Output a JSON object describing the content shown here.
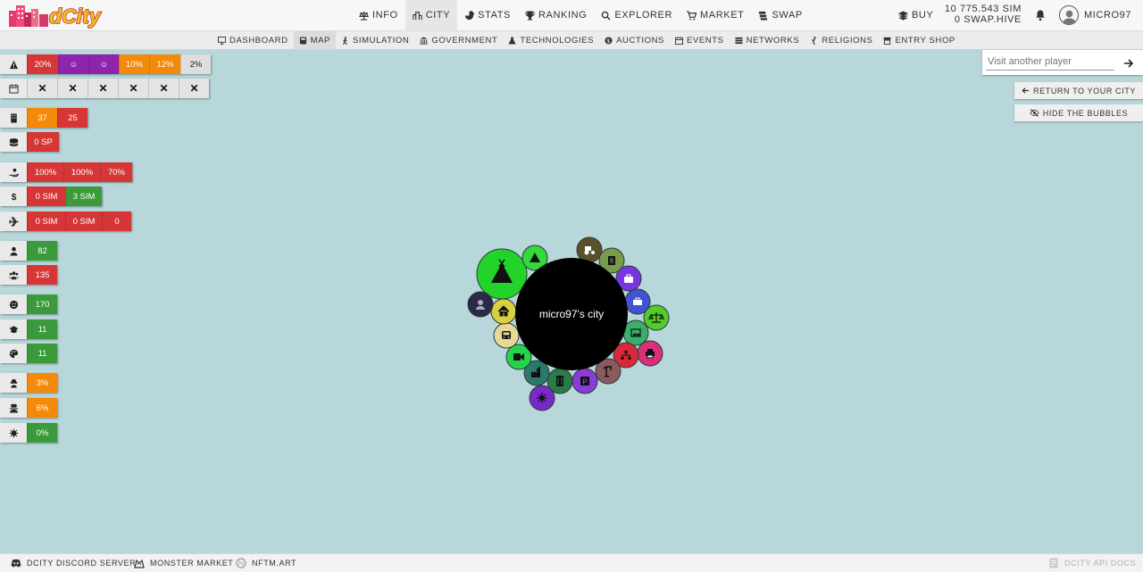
{
  "brand": {
    "logo_text": "dCity"
  },
  "topnav": [
    {
      "label": "Info",
      "icon": "balance-scale-icon"
    },
    {
      "label": "City",
      "icon": "city-icon",
      "active": true
    },
    {
      "label": "Stats",
      "icon": "pie-chart-icon"
    },
    {
      "label": "Ranking",
      "icon": "trophy-icon"
    },
    {
      "label": "Explorer",
      "icon": "search-icon"
    },
    {
      "label": "Market",
      "icon": "cart-icon"
    },
    {
      "label": "Swap",
      "icon": "swap-icon"
    }
  ],
  "header": {
    "buy_label": "Buy",
    "balance_sim": "10 775.543 SIM",
    "balance_swap": "0 SWAP.HIVE",
    "username": "MICRO97"
  },
  "subnav": [
    {
      "label": "Dashboard",
      "icon": "monitor-icon"
    },
    {
      "label": "Map",
      "icon": "map-icon",
      "active": true
    },
    {
      "label": "Simulation",
      "icon": "walking-icon"
    },
    {
      "label": "Government",
      "icon": "government-icon"
    },
    {
      "label": "Technologies",
      "icon": "flask-icon"
    },
    {
      "label": "Auctions",
      "icon": "gavel-icon"
    },
    {
      "label": "Events",
      "icon": "calendar-icon"
    },
    {
      "label": "Networks",
      "icon": "network-icon"
    },
    {
      "label": "Religions",
      "icon": "pray-icon"
    },
    {
      "label": "Entry Shop",
      "icon": "shop-icon"
    }
  ],
  "stats_rows": [
    {
      "icon": "warning-icon",
      "cells": [
        {
          "text": "20%",
          "color": "red"
        },
        {
          "text": "☺",
          "color": "purple"
        },
        {
          "text": "☺",
          "color": "purple"
        },
        {
          "text": "10%",
          "color": "orange"
        },
        {
          "text": "12%",
          "color": "orange"
        },
        {
          "text": "2%",
          "color": "grey"
        }
      ]
    },
    {
      "icon": "calendar-icon",
      "cells": [
        {
          "text": "✕",
          "color": "x"
        },
        {
          "text": "✕",
          "color": "x"
        },
        {
          "text": "✕",
          "color": "x"
        },
        {
          "text": "✕",
          "color": "x"
        },
        {
          "text": "✕",
          "color": "x"
        },
        {
          "text": "✕",
          "color": "x"
        }
      ]
    },
    {
      "icon": "building-icon",
      "cells": [
        {
          "text": "37",
          "color": "orange"
        },
        {
          "text": "25",
          "color": "red"
        }
      ]
    },
    {
      "icon": "coins-icon",
      "cells": [
        {
          "text": "0 SP",
          "color": "red"
        }
      ]
    },
    {
      "icon": "hand-coin-icon",
      "cells": [
        {
          "text": "100%",
          "color": "red"
        },
        {
          "text": "100%",
          "color": "red"
        },
        {
          "text": "70%",
          "color": "red"
        }
      ]
    },
    {
      "icon": "dollar-icon",
      "cells": [
        {
          "text": "0 SIM",
          "color": "red"
        },
        {
          "text": "3 SIM",
          "color": "green"
        }
      ]
    },
    {
      "icon": "plane-icon",
      "cells": [
        {
          "text": "0 SIM",
          "color": "red"
        },
        {
          "text": "0 SIM",
          "color": "red"
        },
        {
          "text": "0",
          "color": "red"
        }
      ]
    },
    {
      "icon": "person-icon",
      "cells": [
        {
          "text": "82",
          "color": "green"
        }
      ]
    },
    {
      "icon": "people-icon",
      "cells": [
        {
          "text": "135",
          "color": "red"
        }
      ]
    },
    {
      "icon": "smile-icon",
      "cells": [
        {
          "text": "170",
          "color": "green"
        }
      ]
    },
    {
      "icon": "graduation-cap-icon",
      "cells": [
        {
          "text": "11",
          "color": "green"
        }
      ]
    },
    {
      "icon": "palette-icon",
      "cells": [
        {
          "text": "11",
          "color": "green"
        }
      ]
    },
    {
      "icon": "thief-icon",
      "cells": [
        {
          "text": "3%",
          "color": "orange"
        }
      ]
    },
    {
      "icon": "unemployed-icon",
      "cells": [
        {
          "text": "6%",
          "color": "orange"
        }
      ]
    },
    {
      "icon": "virus-icon",
      "cells": [
        {
          "text": "0%",
          "color": "green"
        }
      ]
    }
  ],
  "search": {
    "placeholder": "Visit another player"
  },
  "actions": {
    "return_label": "Return to your city",
    "hide_label": "Hide the bubbles"
  },
  "city": {
    "name": "micro97's city",
    "bubbles": [
      {
        "label": "camping-icon",
        "color": "#22d42a"
      },
      {
        "label": "camping-small-icon",
        "color": "#33d93a"
      },
      {
        "label": "tractor-icon",
        "color": "#5b5128"
      },
      {
        "label": "clipboard-icon",
        "color": "#7a9a4c"
      },
      {
        "label": "briefcase-icon",
        "color": "#7a35e0"
      },
      {
        "label": "toolbox-icon",
        "color": "#4053d0"
      },
      {
        "label": "justice-icon",
        "color": "#4fcd2a"
      },
      {
        "label": "image-icon",
        "color": "#38b06a"
      },
      {
        "label": "printer-icon",
        "color": "#d8307a"
      },
      {
        "label": "network-icon",
        "color": "#d8283a"
      },
      {
        "label": "crane-icon",
        "color": "#8a5a5e"
      },
      {
        "label": "parking-icon",
        "color": "#8a3cd8"
      },
      {
        "label": "office-icon",
        "color": "#2a7a4a"
      },
      {
        "label": "factory-icon",
        "color": "#2a7a6a"
      },
      {
        "label": "virus-bubble-icon",
        "color": "#7a28c8"
      },
      {
        "label": "camera-icon",
        "color": "#22d44a"
      },
      {
        "label": "bus-icon",
        "color": "#e8d898"
      },
      {
        "label": "home-icon",
        "color": "#d8d040"
      },
      {
        "label": "user-tie-icon",
        "color": "#2a2a48"
      }
    ]
  },
  "footer": [
    {
      "label": "dCity Discord Server",
      "icon": "discord-icon"
    },
    {
      "label": "Monster Market",
      "icon": "monster-icon"
    },
    {
      "label": "NFTM.ART",
      "icon": "nftm-icon"
    },
    {
      "label": "dCity API Docs",
      "icon": "docs-icon"
    }
  ]
}
